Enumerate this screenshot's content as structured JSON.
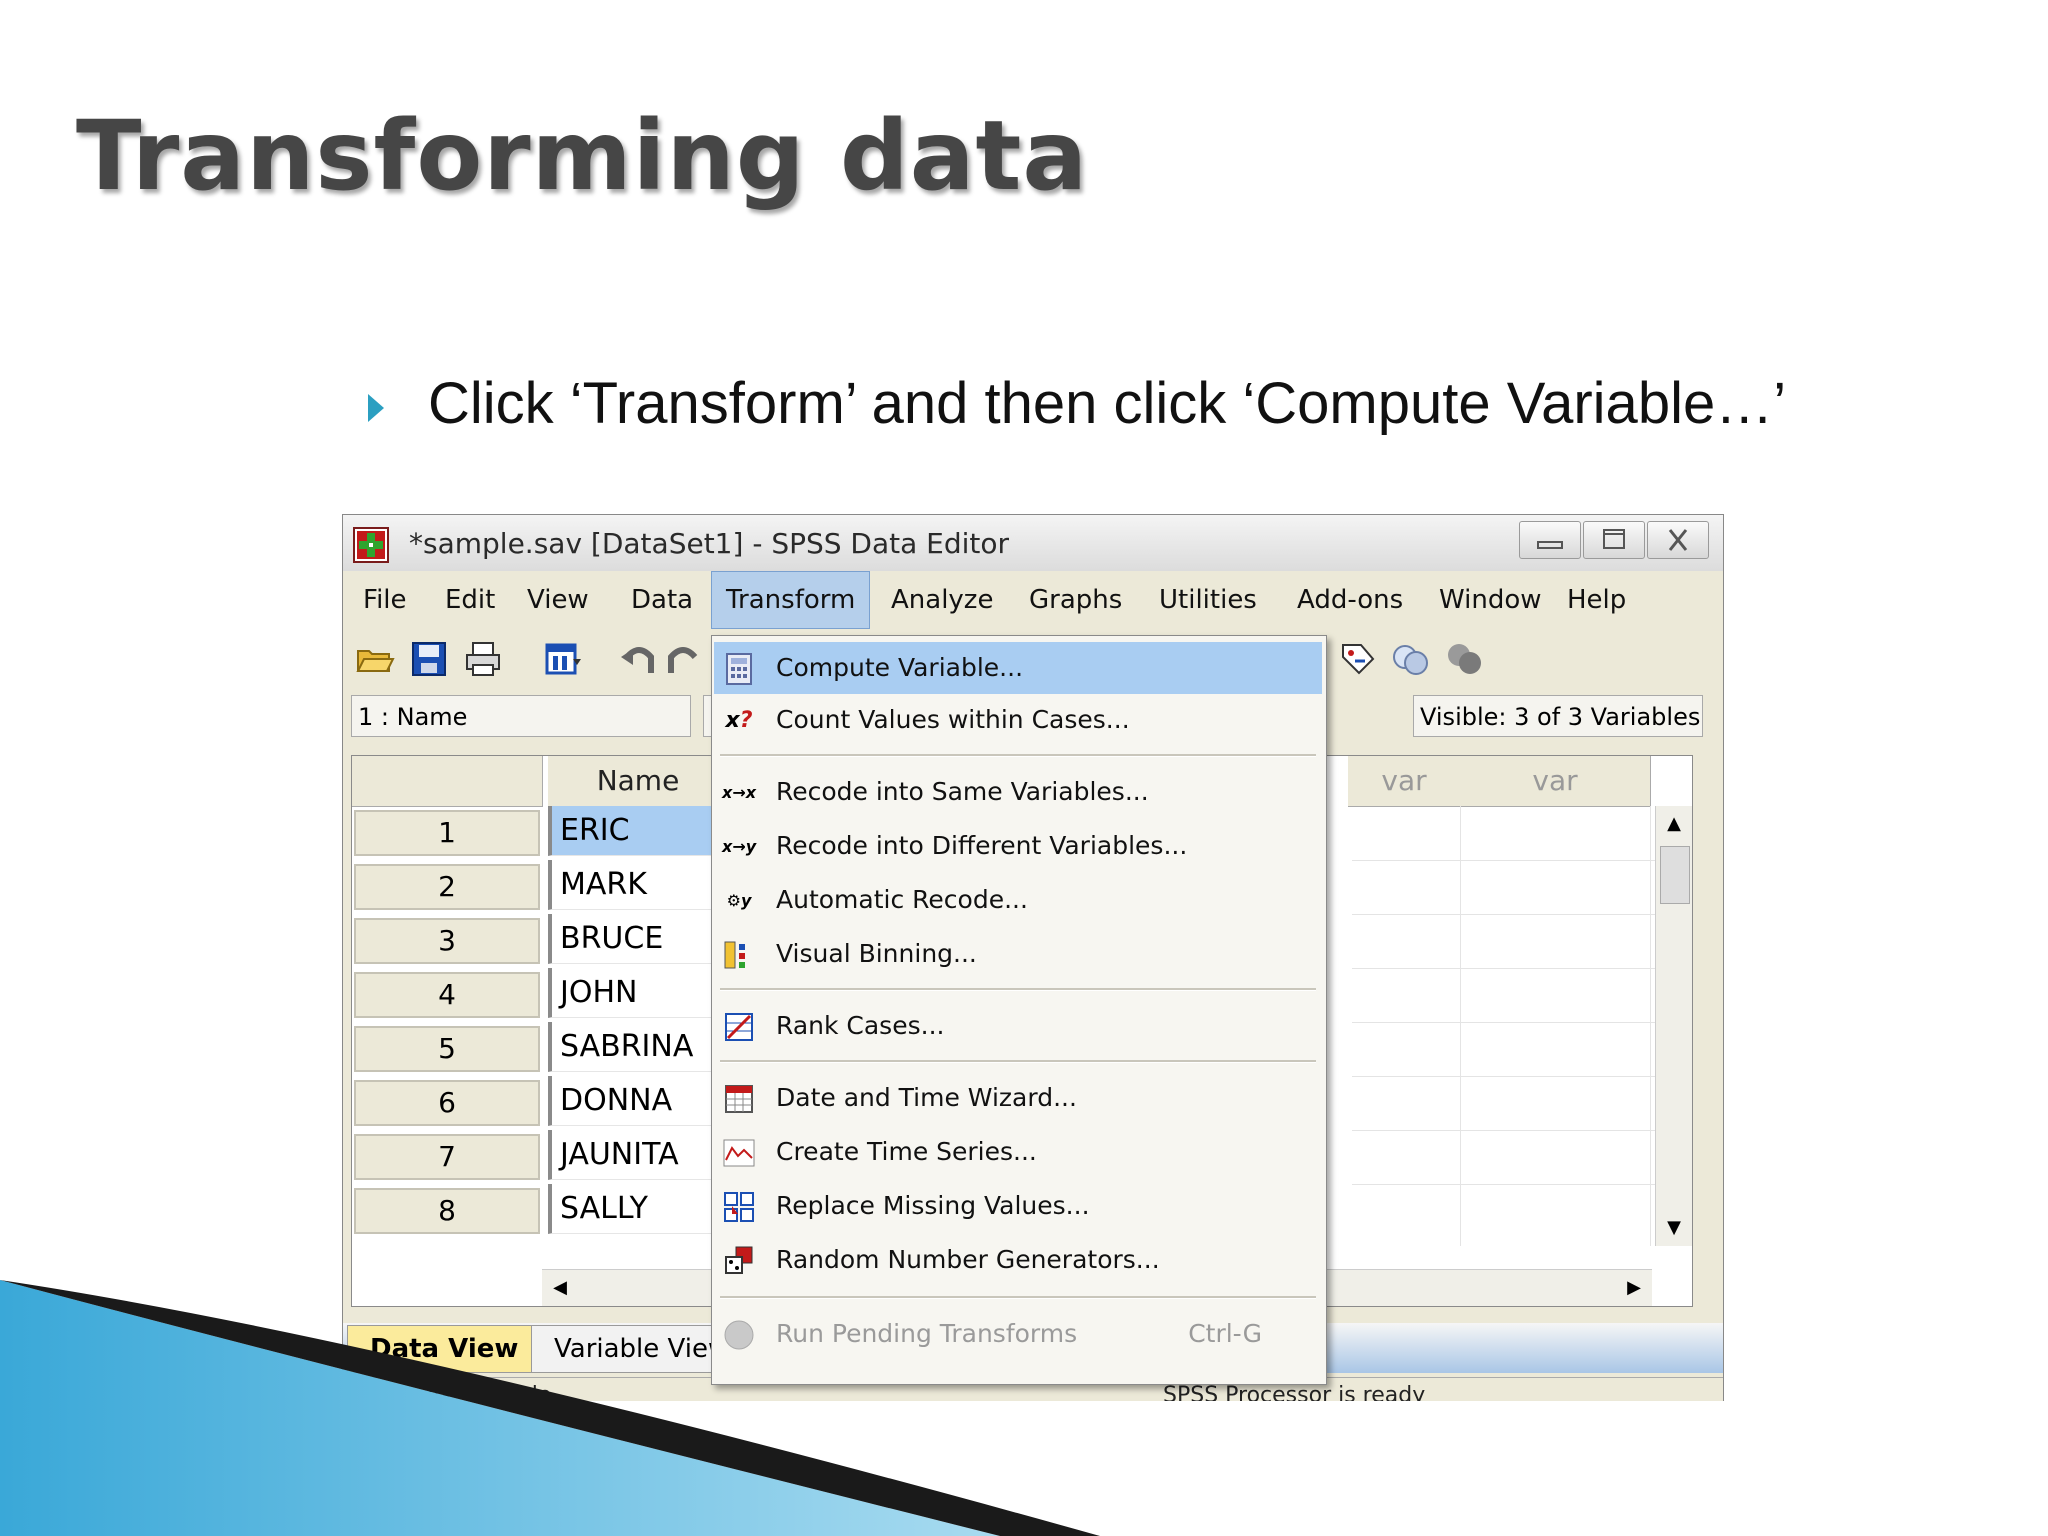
{
  "slide": {
    "title": "Transforming data",
    "bullet": "Click ‘Transform’ and then click ‘Compute Variable…’"
  },
  "window": {
    "title": "*sample.sav [DataSet1] - SPSS Data Editor",
    "controls": [
      "minimize-icon",
      "maximize-icon",
      "close-icon"
    ]
  },
  "menubar": [
    {
      "label": "File"
    },
    {
      "label": "Edit"
    },
    {
      "label": "View"
    },
    {
      "label": "Data"
    },
    {
      "label": "Transform"
    },
    {
      "label": "Analyze"
    },
    {
      "label": "Graphs"
    },
    {
      "label": "Utilities"
    },
    {
      "label": "Add-ons"
    },
    {
      "label": "Window"
    },
    {
      "label": "Help"
    }
  ],
  "toolbar": {
    "icons": [
      "open-folder-icon",
      "save-icon",
      "print-icon",
      "dialog-recall-icon",
      "undo-icon",
      "redo-icon",
      "value-labels-icon",
      "use-sets-icon",
      "show-all-icon"
    ]
  },
  "namebar": {
    "cell_ref": "1 : Name",
    "visible": "Visible: 3 of 3 Variables"
  },
  "grid": {
    "columns": [
      "Name",
      "var",
      "var"
    ],
    "rows": [
      {
        "num": "1",
        "name": "ERIC"
      },
      {
        "num": "2",
        "name": "MARK"
      },
      {
        "num": "3",
        "name": "BRUCE"
      },
      {
        "num": "4",
        "name": "JOHN"
      },
      {
        "num": "5",
        "name": "SABRINA"
      },
      {
        "num": "6",
        "name": "DONNA"
      },
      {
        "num": "7",
        "name": "JAUNITA"
      },
      {
        "num": "8",
        "name": "SALLY"
      }
    ]
  },
  "tabs": {
    "data_view": "Data View",
    "variable_view": "Variable View"
  },
  "status": {
    "left": "Compute Variable...",
    "right": "SPSS Processor is ready"
  },
  "transform_menu": {
    "items": [
      {
        "label": "Compute Variable...",
        "icon": "calculator-icon",
        "state": "highlighted"
      },
      {
        "label": "Count Values within Cases...",
        "icon": "count-values-icon"
      },
      {
        "label": "Recode into Same Variables...",
        "icon": "recode-same-icon"
      },
      {
        "label": "Recode into Different Variables...",
        "icon": "recode-different-icon"
      },
      {
        "label": "Automatic Recode...",
        "icon": "automatic-recode-icon"
      },
      {
        "label": "Visual Binning...",
        "icon": "visual-binning-icon"
      },
      {
        "label": "Rank Cases...",
        "icon": "rank-cases-icon"
      },
      {
        "label": "Date and Time Wizard...",
        "icon": "calendar-icon"
      },
      {
        "label": "Create Time Series...",
        "icon": "time-series-icon"
      },
      {
        "label": "Replace Missing Values...",
        "icon": "replace-missing-icon"
      },
      {
        "label": "Random Number Generators...",
        "icon": "dice-icon"
      },
      {
        "label": "Run Pending Transforms",
        "icon": "run-pending-icon",
        "shortcut": "Ctrl-G",
        "state": "disabled"
      }
    ]
  },
  "colors": {
    "bullet": "#2b9fc1",
    "highlight": "#a9cdf2",
    "swoosh_dark": "#1a1a1a",
    "swoosh_blue": "#3aa8d8"
  }
}
